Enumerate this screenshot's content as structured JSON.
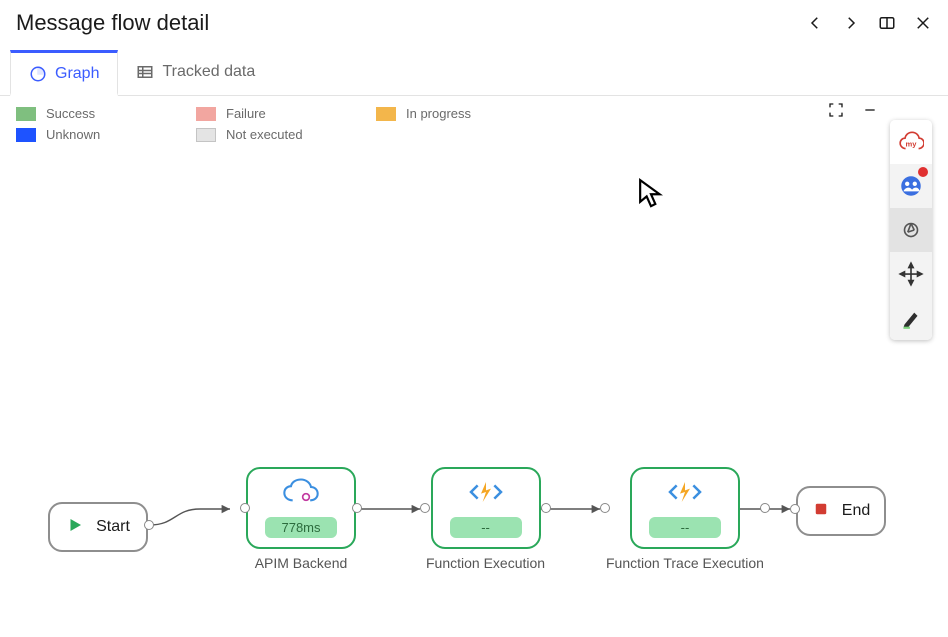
{
  "header": {
    "title": "Message flow detail"
  },
  "tabs": {
    "graph": "Graph",
    "tracked": "Tracked data",
    "active": "graph"
  },
  "legend": {
    "success": "Success",
    "unknown": "Unknown",
    "failure": "Failure",
    "notexec": "Not executed",
    "inprog": "In progress"
  },
  "colors": {
    "success": "#7fbf7f",
    "unknown": "#1e53ff",
    "failure": "#f2a6a0",
    "notexec": "#e4e4e4",
    "inprog": "#f3b64b",
    "accent": "#3b5cff",
    "green": "#2aa85a",
    "red": "#d23c32"
  },
  "flow": {
    "start": {
      "label": "Start"
    },
    "end": {
      "label": "End"
    },
    "nodes": [
      {
        "id": "apim",
        "title": "APIM Backend",
        "chip": "778ms",
        "icon": "cloud"
      },
      {
        "id": "fexec",
        "title": "Function Execution",
        "chip": "--",
        "icon": "function"
      },
      {
        "id": "ftrace",
        "title": "Function Trace Execution",
        "chip": "--",
        "icon": "function"
      }
    ]
  }
}
